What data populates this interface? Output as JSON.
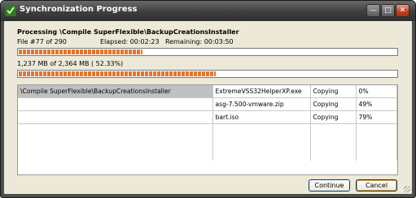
{
  "window": {
    "title": "Synchronization Progress"
  },
  "status": {
    "processing": "Processing  \\Compile SuperFlexible\\BackupCreationsInstaller",
    "file_count": "File #77 of 290",
    "elapsed": "Elapsed: 00:02:23",
    "remaining": "Remaining: 00:03:50",
    "bytes": "1,237 MB of 2,364 MB ( 52.33%)",
    "file_progress_fraction": 0.33,
    "total_progress_fraction": 0.5233
  },
  "rows": [
    {
      "folder": "\\Compile SuperFlexible\\BackupCreationsInstaller",
      "file": "ExtremeVSS32HelperXP.exe",
      "action": "Copying",
      "percent": "0%"
    },
    {
      "folder": "",
      "file": "asg-7.500-vmware.zip",
      "action": "Copying",
      "percent": "49%"
    },
    {
      "folder": "",
      "file": "bart.iso",
      "action": "Copying",
      "percent": "79%"
    }
  ],
  "buttons": {
    "continue": "Continue",
    "cancel": "Cancel"
  },
  "colors": {
    "progress": "#e8742a",
    "selection": "#c0c0c0"
  }
}
